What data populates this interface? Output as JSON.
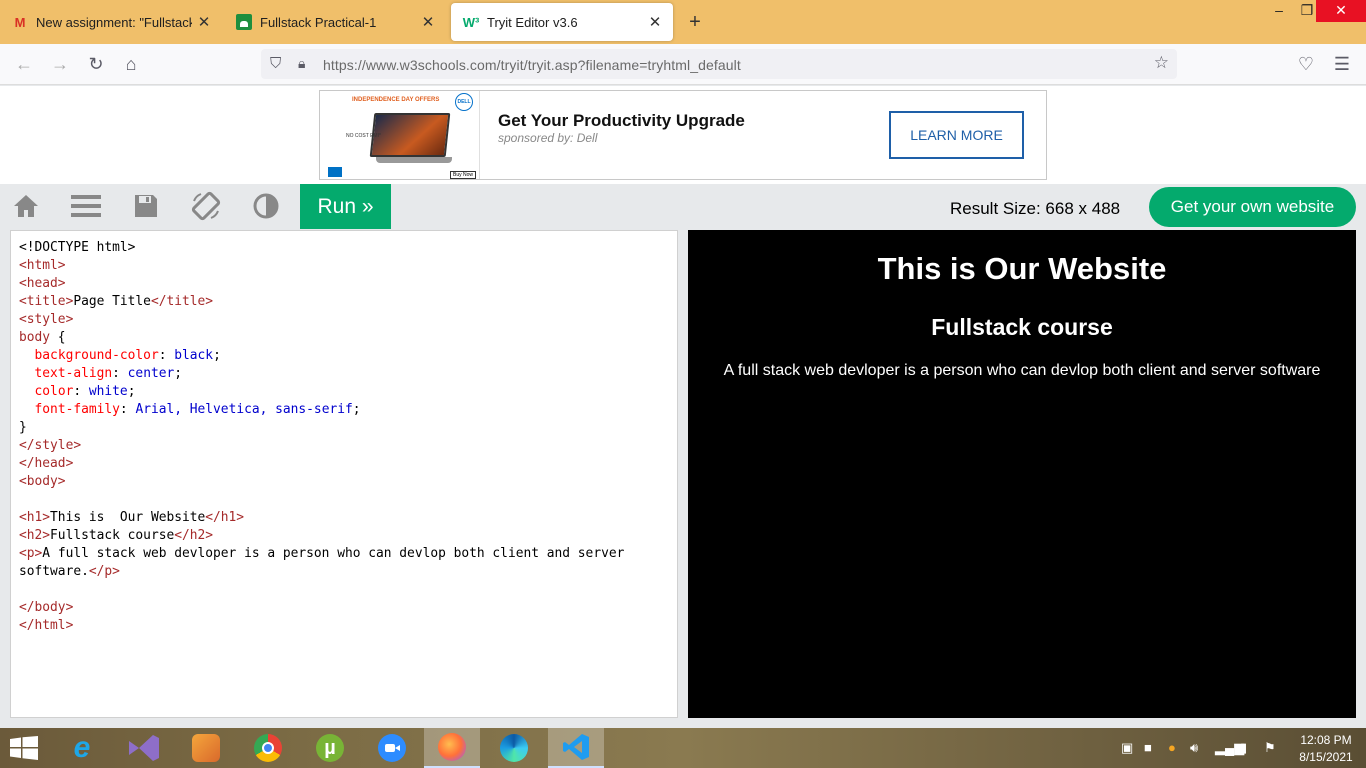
{
  "browser": {
    "tabs": [
      {
        "label": "New assignment: \"Fullstack Pra",
        "icon": "gmail-icon"
      },
      {
        "label": "Fullstack Practical-1",
        "icon": "classroom-icon"
      },
      {
        "label": "Tryit Editor v3.6",
        "icon": "w3schools-icon"
      }
    ],
    "url": "https://www.w3schools.com/tryit/tryit.asp?filename=tryhtml_default"
  },
  "ad": {
    "title": "Get Your Productivity Upgrade",
    "sponsor": "sponsored by: Dell",
    "cta": "LEARN MORE",
    "image_text": {
      "offer": "INDEPENDENCE DAY OFFERS",
      "brand": "DELL",
      "no_cost": "NO COST EMI*",
      "buy_now": "Buy Now"
    }
  },
  "toolbar": {
    "run_label": "Run »",
    "result_size": "Result Size: 668 x 488",
    "own_website": "Get your own website"
  },
  "editor": {
    "lines": [
      "<!DOCTYPE html>",
      "<html>",
      "<head>",
      "<title>Page Title</title>",
      "<style>",
      "body {",
      "  background-color: black;",
      "  text-align: center;",
      "  color: white;",
      "  font-family: Arial, Helvetica, sans-serif;",
      "}",
      "</style>",
      "</head>",
      "<body>",
      "",
      "<h1>This is  Our Website</h1>",
      "<h2>Fullstack course</h2>",
      "<p>A full stack web devloper is a person who can devlop both client and server",
      "software.</p>",
      "",
      "</body>",
      "</html>"
    ]
  },
  "result": {
    "h1": "This is Our Website",
    "h2": "Fullstack course",
    "p": "A full stack web devloper is a person who can devlop both client and server software"
  },
  "taskbar": {
    "apps": [
      "internet-explorer-icon",
      "visual-studio-icon",
      "sublime-text-icon",
      "chrome-icon",
      "utorrent-icon",
      "zoom-icon",
      "firefox-icon",
      "edge-icon",
      "vscode-icon"
    ],
    "time": "12:08 PM",
    "date": "8/15/2021"
  },
  "colors": {
    "accent_green": "#04aa6d",
    "tabstrip": "#f0bf6a",
    "result_bg": "#000000"
  }
}
